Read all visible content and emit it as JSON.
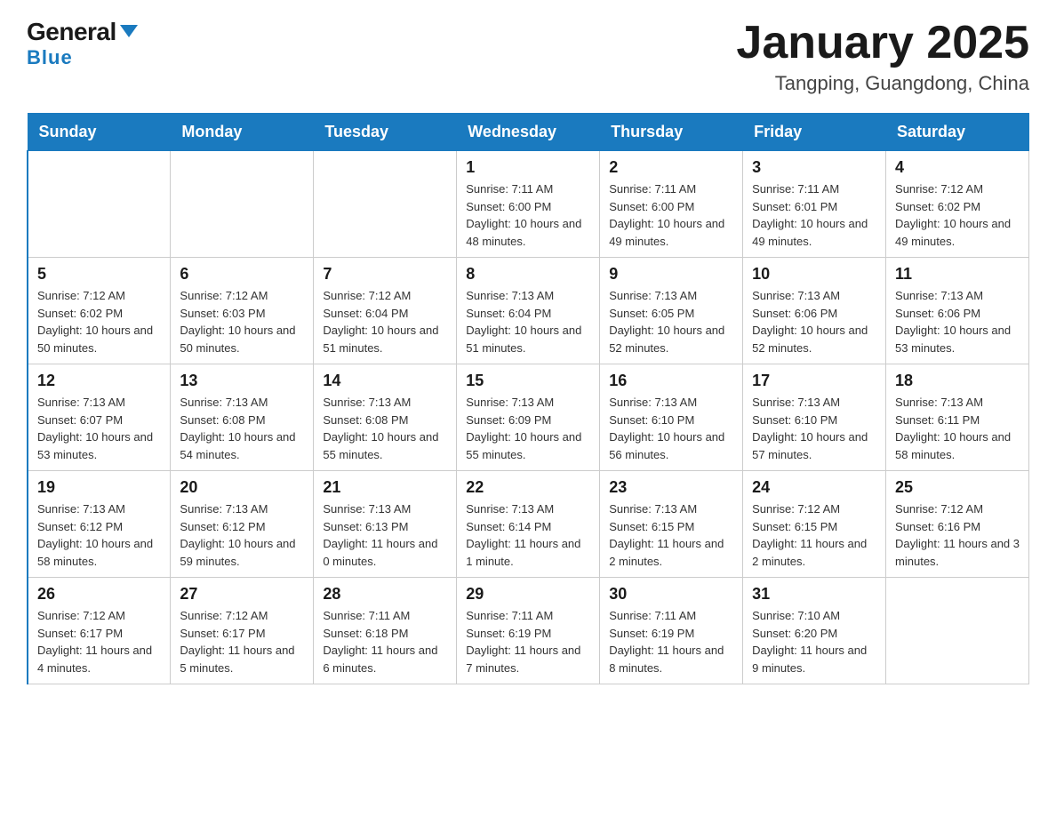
{
  "header": {
    "logo_general": "General",
    "logo_blue": "Blue",
    "month_title": "January 2025",
    "location": "Tangping, Guangdong, China"
  },
  "days_of_week": [
    "Sunday",
    "Monday",
    "Tuesday",
    "Wednesday",
    "Thursday",
    "Friday",
    "Saturday"
  ],
  "weeks": [
    {
      "days": [
        {
          "date": "",
          "info": ""
        },
        {
          "date": "",
          "info": ""
        },
        {
          "date": "",
          "info": ""
        },
        {
          "date": "1",
          "info": "Sunrise: 7:11 AM\nSunset: 6:00 PM\nDaylight: 10 hours and 48 minutes."
        },
        {
          "date": "2",
          "info": "Sunrise: 7:11 AM\nSunset: 6:00 PM\nDaylight: 10 hours and 49 minutes."
        },
        {
          "date": "3",
          "info": "Sunrise: 7:11 AM\nSunset: 6:01 PM\nDaylight: 10 hours and 49 minutes."
        },
        {
          "date": "4",
          "info": "Sunrise: 7:12 AM\nSunset: 6:02 PM\nDaylight: 10 hours and 49 minutes."
        }
      ]
    },
    {
      "days": [
        {
          "date": "5",
          "info": "Sunrise: 7:12 AM\nSunset: 6:02 PM\nDaylight: 10 hours and 50 minutes."
        },
        {
          "date": "6",
          "info": "Sunrise: 7:12 AM\nSunset: 6:03 PM\nDaylight: 10 hours and 50 minutes."
        },
        {
          "date": "7",
          "info": "Sunrise: 7:12 AM\nSunset: 6:04 PM\nDaylight: 10 hours and 51 minutes."
        },
        {
          "date": "8",
          "info": "Sunrise: 7:13 AM\nSunset: 6:04 PM\nDaylight: 10 hours and 51 minutes."
        },
        {
          "date": "9",
          "info": "Sunrise: 7:13 AM\nSunset: 6:05 PM\nDaylight: 10 hours and 52 minutes."
        },
        {
          "date": "10",
          "info": "Sunrise: 7:13 AM\nSunset: 6:06 PM\nDaylight: 10 hours and 52 minutes."
        },
        {
          "date": "11",
          "info": "Sunrise: 7:13 AM\nSunset: 6:06 PM\nDaylight: 10 hours and 53 minutes."
        }
      ]
    },
    {
      "days": [
        {
          "date": "12",
          "info": "Sunrise: 7:13 AM\nSunset: 6:07 PM\nDaylight: 10 hours and 53 minutes."
        },
        {
          "date": "13",
          "info": "Sunrise: 7:13 AM\nSunset: 6:08 PM\nDaylight: 10 hours and 54 minutes."
        },
        {
          "date": "14",
          "info": "Sunrise: 7:13 AM\nSunset: 6:08 PM\nDaylight: 10 hours and 55 minutes."
        },
        {
          "date": "15",
          "info": "Sunrise: 7:13 AM\nSunset: 6:09 PM\nDaylight: 10 hours and 55 minutes."
        },
        {
          "date": "16",
          "info": "Sunrise: 7:13 AM\nSunset: 6:10 PM\nDaylight: 10 hours and 56 minutes."
        },
        {
          "date": "17",
          "info": "Sunrise: 7:13 AM\nSunset: 6:10 PM\nDaylight: 10 hours and 57 minutes."
        },
        {
          "date": "18",
          "info": "Sunrise: 7:13 AM\nSunset: 6:11 PM\nDaylight: 10 hours and 58 minutes."
        }
      ]
    },
    {
      "days": [
        {
          "date": "19",
          "info": "Sunrise: 7:13 AM\nSunset: 6:12 PM\nDaylight: 10 hours and 58 minutes."
        },
        {
          "date": "20",
          "info": "Sunrise: 7:13 AM\nSunset: 6:12 PM\nDaylight: 10 hours and 59 minutes."
        },
        {
          "date": "21",
          "info": "Sunrise: 7:13 AM\nSunset: 6:13 PM\nDaylight: 11 hours and 0 minutes."
        },
        {
          "date": "22",
          "info": "Sunrise: 7:13 AM\nSunset: 6:14 PM\nDaylight: 11 hours and 1 minute."
        },
        {
          "date": "23",
          "info": "Sunrise: 7:13 AM\nSunset: 6:15 PM\nDaylight: 11 hours and 2 minutes."
        },
        {
          "date": "24",
          "info": "Sunrise: 7:12 AM\nSunset: 6:15 PM\nDaylight: 11 hours and 2 minutes."
        },
        {
          "date": "25",
          "info": "Sunrise: 7:12 AM\nSunset: 6:16 PM\nDaylight: 11 hours and 3 minutes."
        }
      ]
    },
    {
      "days": [
        {
          "date": "26",
          "info": "Sunrise: 7:12 AM\nSunset: 6:17 PM\nDaylight: 11 hours and 4 minutes."
        },
        {
          "date": "27",
          "info": "Sunrise: 7:12 AM\nSunset: 6:17 PM\nDaylight: 11 hours and 5 minutes."
        },
        {
          "date": "28",
          "info": "Sunrise: 7:11 AM\nSunset: 6:18 PM\nDaylight: 11 hours and 6 minutes."
        },
        {
          "date": "29",
          "info": "Sunrise: 7:11 AM\nSunset: 6:19 PM\nDaylight: 11 hours and 7 minutes."
        },
        {
          "date": "30",
          "info": "Sunrise: 7:11 AM\nSunset: 6:19 PM\nDaylight: 11 hours and 8 minutes."
        },
        {
          "date": "31",
          "info": "Sunrise: 7:10 AM\nSunset: 6:20 PM\nDaylight: 11 hours and 9 minutes."
        },
        {
          "date": "",
          "info": ""
        }
      ]
    }
  ]
}
